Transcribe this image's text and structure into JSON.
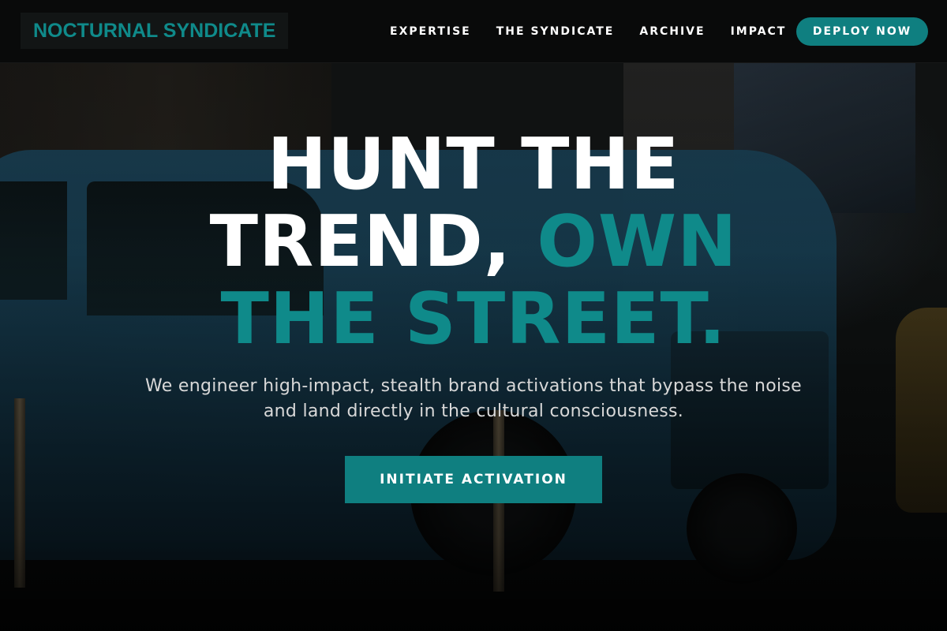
{
  "brand": {
    "logo_text": "NOCTURNAL SYNDICATE",
    "accent_color": "#0f8a8a"
  },
  "nav": {
    "items": [
      {
        "label": "EXPERTISE"
      },
      {
        "label": "THE SYNDICATE"
      },
      {
        "label": "ARCHIVE"
      },
      {
        "label": "IMPACT"
      }
    ],
    "cta_label": "DEPLOY NOW"
  },
  "hero": {
    "title_line1": "HUNT THE",
    "title_line2_white": "TREND, ",
    "title_line2_accent": "OWN",
    "title_line3_accent": "THE STREET.",
    "subtitle": "We engineer high-impact, stealth brand activations that bypass the noise and land directly in the cultural consciousness.",
    "cta_label": "INITIATE ACTIVATION"
  }
}
